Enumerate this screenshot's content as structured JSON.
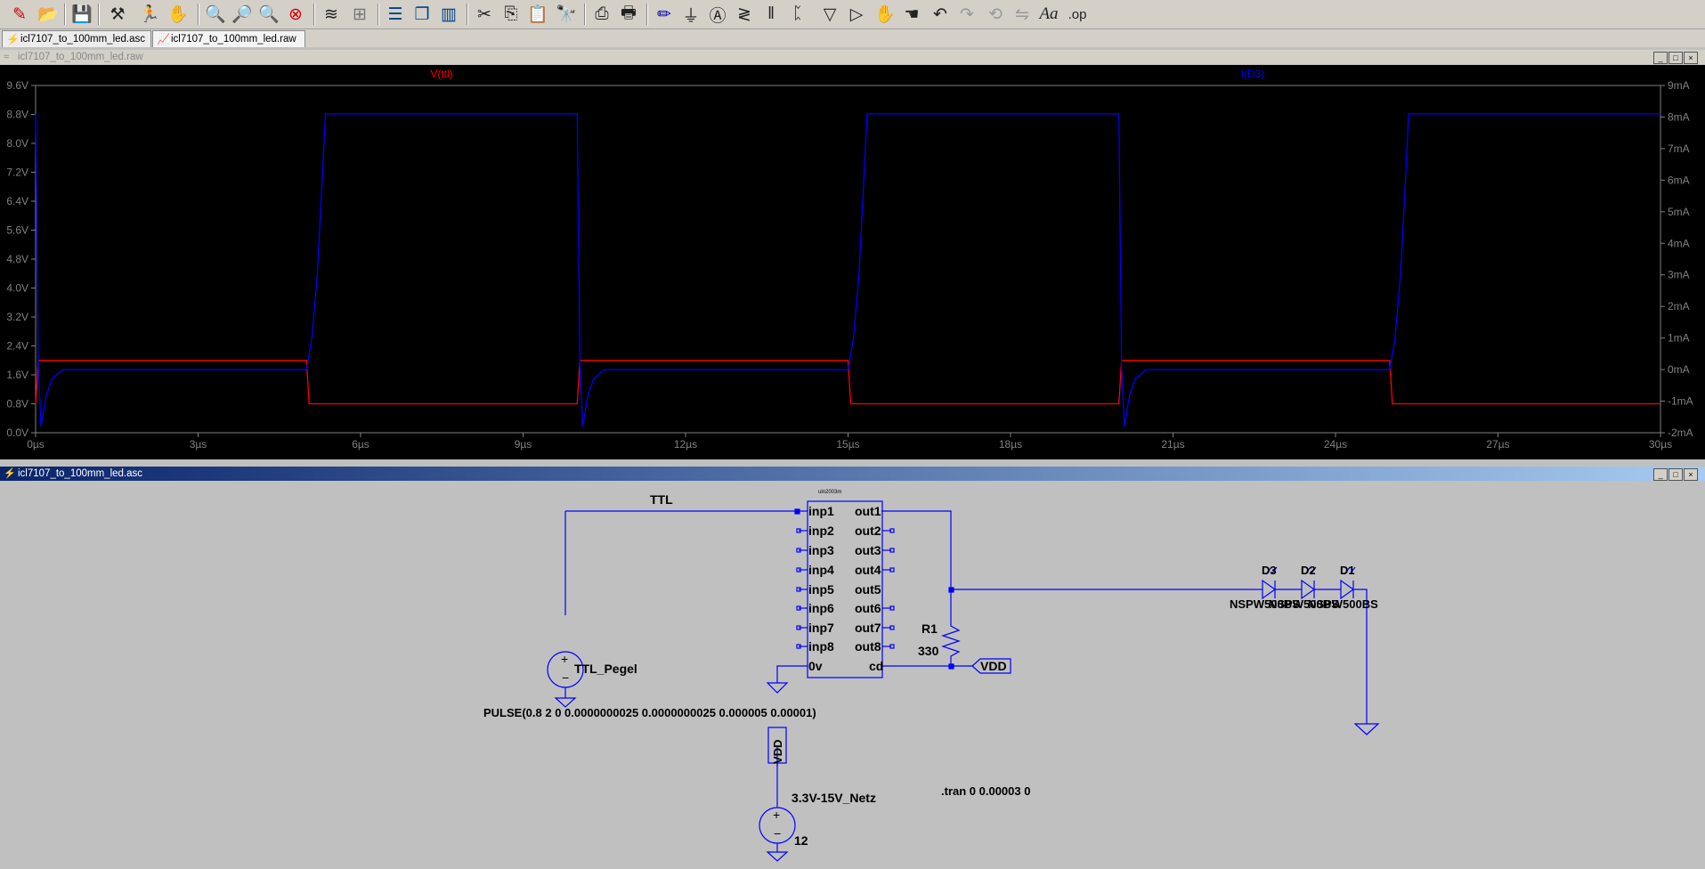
{
  "toolbar": {
    "icons": [
      "new-schematic-icon",
      "open-folder-icon",
      "save-icon",
      "control-panel-icon",
      "run-icon",
      "halt-icon",
      "zoom-in-icon",
      "zoom-area-icon",
      "zoom-out-icon",
      "zoom-fit-icon",
      "autorange-icon",
      "grid-icon",
      "tile-horizontal-icon",
      "cascade-icon",
      "tile-vertical-icon",
      "cut-icon",
      "copy-icon",
      "paste-icon",
      "find-icon",
      "print-setup-icon",
      "print-icon",
      "draw-wire-icon",
      "ground-icon",
      "label-net-icon",
      "resistor-icon",
      "capacitor-icon",
      "inductor-icon",
      "diode-icon",
      "component-icon",
      "move-icon",
      "drag-icon",
      "undo-icon",
      "redo-icon",
      "rotate-icon",
      "mirror-icon",
      "text-icon",
      "spice-directive-icon"
    ],
    "text_label": "Aa",
    "op_label": ".op"
  },
  "tabs": [
    {
      "label": "icl7107_to_100mm_led.asc",
      "icon": "schematic-icon"
    },
    {
      "label": "icl7107_to_100mm_led.raw",
      "icon": "waveform-icon"
    }
  ],
  "plot_window": {
    "title": "icl7107_to_100mm_led.raw",
    "trace_labels": {
      "v": "V(ttl)",
      "i": "I(D3)"
    }
  },
  "chart_data": {
    "type": "line",
    "x_ticks": [
      "0µs",
      "3µs",
      "6µs",
      "9µs",
      "12µs",
      "15µs",
      "18µs",
      "21µs",
      "24µs",
      "27µs",
      "30µs"
    ],
    "xlim": [
      0,
      30
    ],
    "y_left_ticks": [
      "9.6V",
      "8.8V",
      "8.0V",
      "7.2V",
      "6.4V",
      "5.6V",
      "4.8V",
      "4.0V",
      "3.2V",
      "2.4V",
      "1.6V",
      "0.8V",
      "0.0V"
    ],
    "ylim_left": [
      0,
      9.6
    ],
    "y_right_ticks": [
      "9mA",
      "8mA",
      "7mA",
      "6mA",
      "5mA",
      "4mA",
      "3mA",
      "2mA",
      "1mA",
      "0mA",
      "-1mA",
      "-2mA"
    ],
    "ylim_right": [
      -2,
      9
    ],
    "grid": false,
    "series": [
      {
        "name": "V(ttl)",
        "color": "#ff0000",
        "axis": "left",
        "x": [
          0,
          0.05,
          5,
          5.05,
          10,
          10.05,
          15,
          15.05,
          20,
          20.05,
          25,
          25.05,
          30
        ],
        "y": [
          0.8,
          2,
          2,
          0.8,
          0.8,
          2,
          2,
          0.8,
          0.8,
          2,
          2,
          0.8,
          0.8
        ]
      },
      {
        "name": "I(D3)",
        "color": "#0000ff",
        "axis": "right",
        "x": [
          0,
          0.05,
          0.1,
          0.2,
          0.3,
          0.5,
          5,
          5.1,
          5.2,
          5.3,
          5.35,
          10,
          10.05,
          10.1,
          10.2,
          10.3,
          10.5,
          15,
          15.1,
          15.2,
          15.3,
          15.35,
          20,
          20.05,
          20.1,
          20.2,
          20.3,
          20.5,
          25,
          25.1,
          25.2,
          25.3,
          25.35,
          30
        ],
        "y": [
          8.1,
          0.1,
          -1.8,
          -0.8,
          -0.3,
          0,
          0,
          1,
          3,
          6.3,
          8.1,
          8.1,
          0.1,
          -1.8,
          -0.8,
          -0.3,
          0,
          0,
          1,
          3,
          6.3,
          8.1,
          8.1,
          0.1,
          -1.8,
          -0.8,
          -0.3,
          0,
          0,
          1,
          3,
          6.3,
          8.1,
          8.1
        ]
      }
    ]
  },
  "schematic_window": {
    "title": "icl7107_to_100mm_led.asc",
    "net_ttl": "TTL",
    "ic_name": "uln2003m",
    "ic_inputs": [
      "inp1",
      "inp2",
      "inp3",
      "inp4",
      "inp5",
      "inp6",
      "inp7",
      "inp8",
      "0v"
    ],
    "ic_outputs": [
      "out1",
      "out2",
      "out3",
      "out4",
      "out5",
      "out6",
      "out7",
      "out8",
      "cd"
    ],
    "r1_name": "R1",
    "r1_value": "330",
    "vdd_label": "VDD",
    "vdd_label_vertical": "VDD",
    "source_ttl_name": "TTL_Pegel",
    "source_ttl_value": "PULSE(0.8 2 0 0.0000000025 0.0000000025 0.000005 0.00001)",
    "source_vdd_name": "3.3V-15V_Netz",
    "source_vdd_value": "12",
    "directive": ".tran 0 0.00003 0",
    "diodes": [
      "D3",
      "D2",
      "D1"
    ],
    "diode_model_text": "NSPW500BS",
    "diode_model_overlap_texts": [
      "NSPW500BS",
      "NSPW500BS"
    ]
  }
}
